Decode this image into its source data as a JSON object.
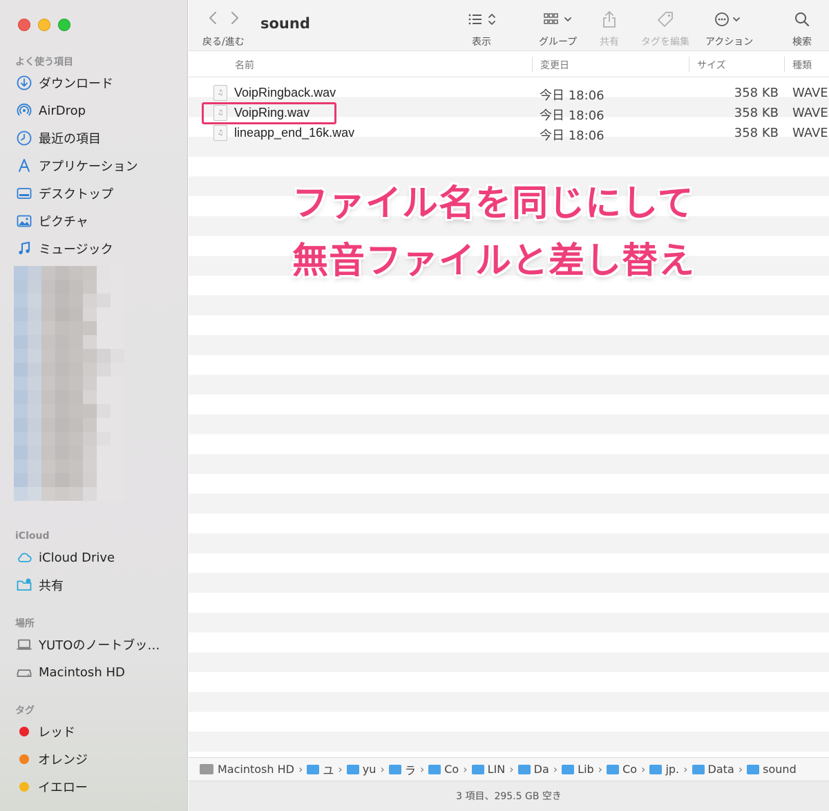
{
  "window": {
    "title": "sound"
  },
  "toolbar": {
    "nav_label": "戻る/進む",
    "view_label": "表示",
    "group_label": "グループ",
    "share_label": "共有",
    "tags_label": "タグを編集",
    "action_label": "アクション",
    "search_label": "検索"
  },
  "sidebar": {
    "favorites_heading": "よく使う項目",
    "favorites": [
      {
        "label": "ダウンロード",
        "icon": "download-icon"
      },
      {
        "label": "AirDrop",
        "icon": "airdrop-icon"
      },
      {
        "label": "最近の項目",
        "icon": "clock-icon"
      },
      {
        "label": "アプリケーション",
        "icon": "applications-icon"
      },
      {
        "label": "デスクトップ",
        "icon": "desktop-icon"
      },
      {
        "label": "ピクチャ",
        "icon": "pictures-icon"
      },
      {
        "label": "ミュージック",
        "icon": "music-icon"
      }
    ],
    "icloud_heading": "iCloud",
    "icloud": [
      {
        "label": "iCloud Drive",
        "icon": "cloud-icon"
      },
      {
        "label": "共有",
        "icon": "shared-folder-icon"
      }
    ],
    "locations_heading": "場所",
    "locations": [
      {
        "label": "YUTOのノートブッ…",
        "icon": "laptop-icon"
      },
      {
        "label": "Macintosh HD",
        "icon": "drive-icon"
      }
    ],
    "tags_heading": "タグ",
    "tags": [
      {
        "label": "レッド",
        "color": "#e8262b"
      },
      {
        "label": "オレンジ",
        "color": "#f3821e"
      },
      {
        "label": "イエロー",
        "color": "#f3b71d"
      }
    ]
  },
  "columns": {
    "name": "名前",
    "date": "変更日",
    "size": "サイズ",
    "kind": "種類"
  },
  "files": [
    {
      "name": "VoipRingback.wav",
      "date": "今日 18:06",
      "size": "358 KB",
      "kind": "WAVE"
    },
    {
      "name": "VoipRing.wav",
      "date": "今日 18:06",
      "size": "358 KB",
      "kind": "WAVE"
    },
    {
      "name": "lineapp_end_16k.wav",
      "date": "今日 18:06",
      "size": "358 KB",
      "kind": "WAVE"
    }
  ],
  "annotation": {
    "line1": "ファイル名を同じにして",
    "line2": "無音ファイルと差し替え",
    "color": "#ee3f7a"
  },
  "pathbar": [
    {
      "label": "Macintosh HD",
      "type": "drive"
    },
    {
      "label": "ユ",
      "type": "folder"
    },
    {
      "label": "yu",
      "type": "folder"
    },
    {
      "label": "ラ",
      "type": "folder"
    },
    {
      "label": "Co",
      "type": "folder"
    },
    {
      "label": "LIN",
      "type": "folder"
    },
    {
      "label": "Da",
      "type": "folder"
    },
    {
      "label": "Lib",
      "type": "folder"
    },
    {
      "label": "Co",
      "type": "folder"
    },
    {
      "label": "jp.",
      "type": "folder"
    },
    {
      "label": "Data",
      "type": "folder"
    },
    {
      "label": "sound",
      "type": "folder"
    }
  ],
  "status": "3 項目、295.5 GB 空き"
}
